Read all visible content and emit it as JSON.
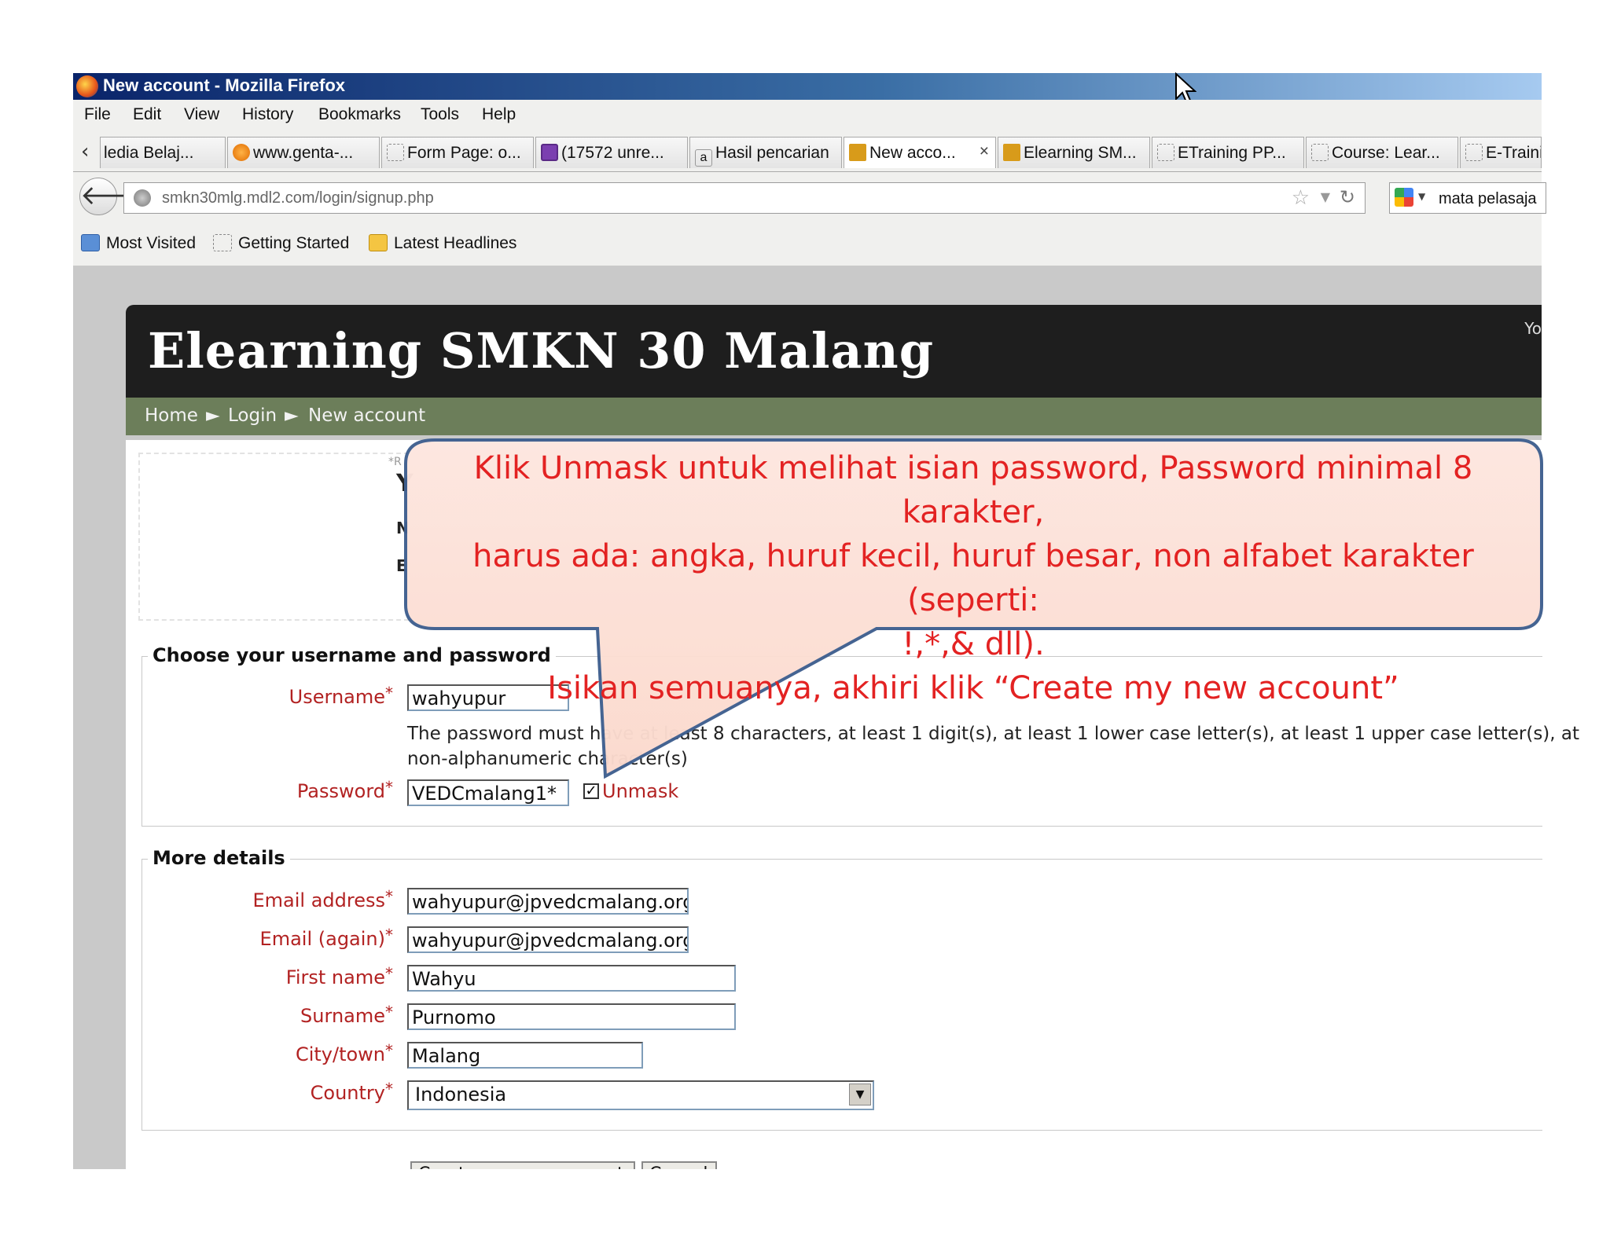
{
  "window": {
    "title": "New account - Mozilla Firefox"
  },
  "menu": [
    "File",
    "Edit",
    "View",
    "History",
    "Bookmarks",
    "Tools",
    "Help"
  ],
  "tabs": [
    "ledia Belaj...",
    "www.genta-...",
    "Form Page: o...",
    "(17572 unre...",
    "Hasil pencarian",
    "New acco...",
    "Elearning SM...",
    "ETraining PP...",
    "Course: Lear...",
    "E-Training F"
  ],
  "tab_close": "×",
  "url": "smkn30mlg.mdl2.com/login/signup.php",
  "search_value": "mata pelasaja",
  "bookmarks": [
    "Most Visited",
    "Getting Started",
    "Latest Headlines"
  ],
  "site": {
    "title": "Elearning SMKN 30 Malang",
    "corner_text": "Yo"
  },
  "breadcrumb": {
    "home": "Home",
    "sep": "►",
    "login": "Login",
    "current": "New account"
  },
  "behind_letters": [
    "*R",
    "Y",
    "N",
    "E"
  ],
  "section1": {
    "legend": "Choose your username and password",
    "username_label": "Username",
    "username_value": "wahyupur",
    "hint_line1": "The password must have at least 8 characters, at least 1 digit(s), at least 1 lower case letter(s), at least 1 upper case letter(s), at",
    "hint_line2": "non-alphanumeric character(s)",
    "password_label": "Password",
    "password_value": "VEDCmalang1*",
    "unmask_label": "Unmask"
  },
  "section2": {
    "legend": "More details",
    "fields": [
      {
        "label": "Email address",
        "value": "wahyupur@jpvedcmalang.org"
      },
      {
        "label": "Email (again)",
        "value": "wahyupur@jpvedcmalang.org"
      },
      {
        "label": "First name",
        "value": "Wahyu"
      },
      {
        "label": "Surname",
        "value": "Purnomo"
      },
      {
        "label": "City/town",
        "value": "Malang"
      },
      {
        "label": "Country",
        "value": "Indonesia"
      }
    ]
  },
  "buttons": {
    "create": "Create my new account",
    "cancel": "Cancel"
  },
  "required_mark": "*",
  "callout": {
    "line1": "Klik Unmask untuk melihat isian password, Password minimal 8 karakter,",
    "line2": "harus ada: angka, huruf kecil, huruf besar, non  alfabet karakter (seperti:",
    "line3": "!,*,& dll).",
    "line4": "Isikan semuanya, akhiri klik “Create my new account”"
  }
}
